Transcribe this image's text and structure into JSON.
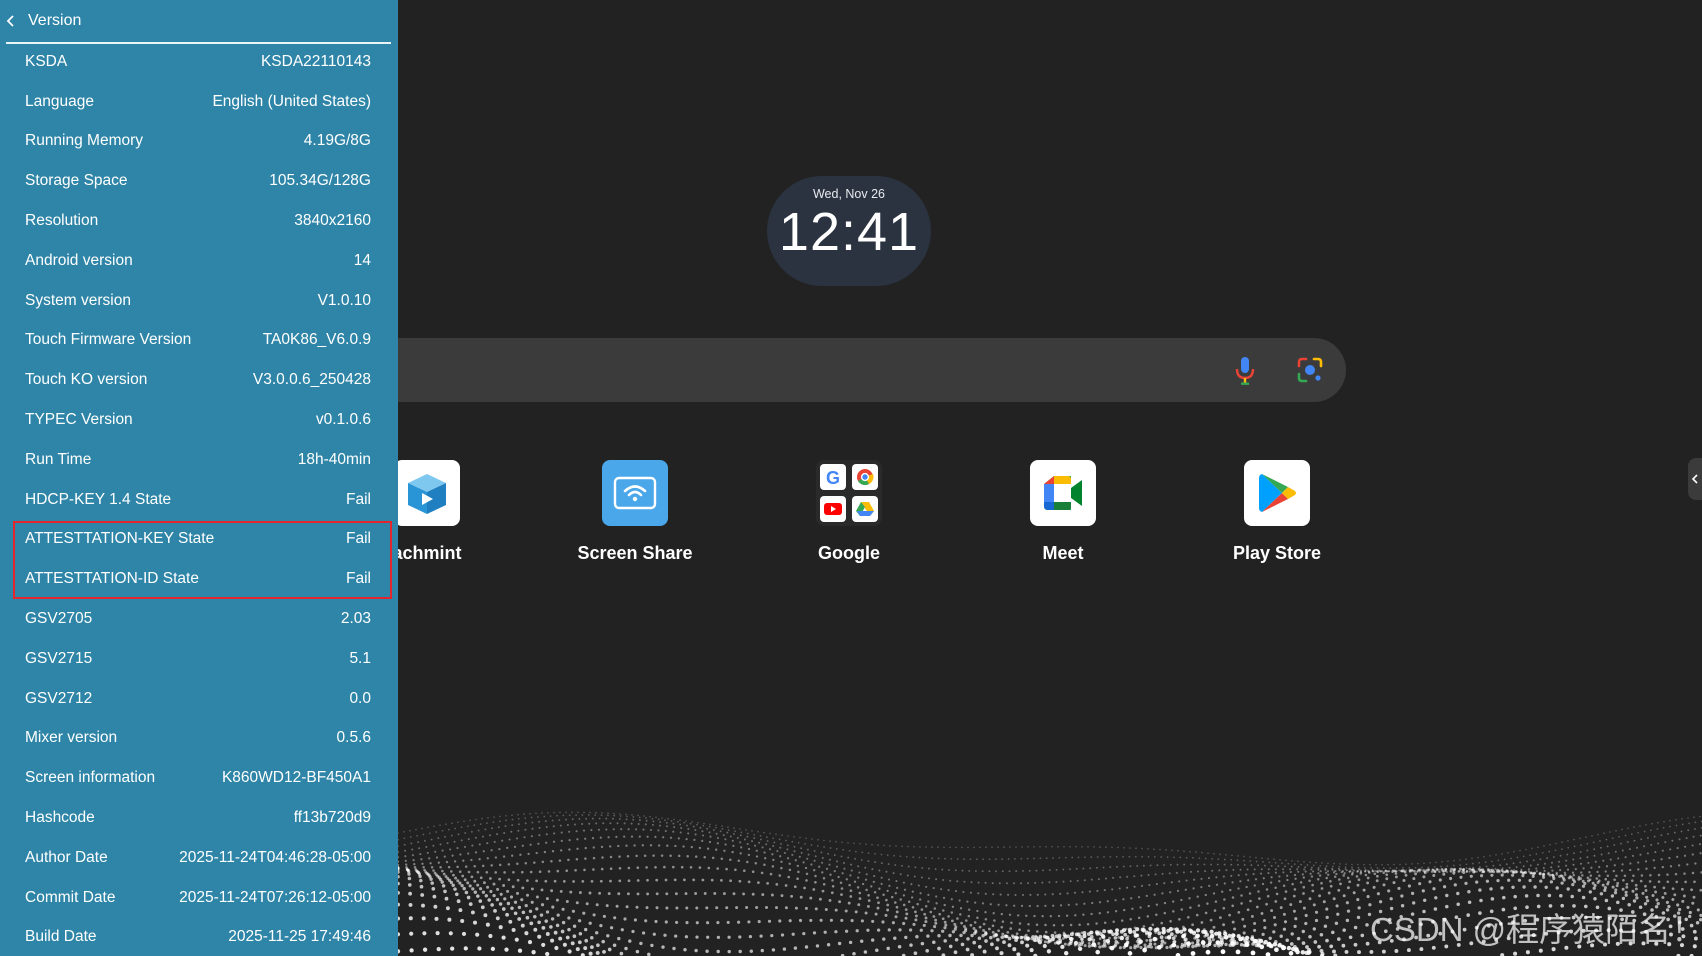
{
  "panel": {
    "title": "Version",
    "rows": [
      {
        "label": "KSDA",
        "value": "KSDA22110143"
      },
      {
        "label": "Language",
        "value": "English (United States)"
      },
      {
        "label": "Running Memory",
        "value": "4.19G/8G"
      },
      {
        "label": "Storage Space",
        "value": "105.34G/128G"
      },
      {
        "label": "Resolution",
        "value": "3840x2160"
      },
      {
        "label": "Android version",
        "value": "14"
      },
      {
        "label": "System version",
        "value": "V1.0.10"
      },
      {
        "label": "Touch Firmware Version",
        "value": "TA0K86_V6.0.9"
      },
      {
        "label": "Touch KO version",
        "value": "V3.0.0.6_250428"
      },
      {
        "label": "TYPEC Version",
        "value": "v0.1.0.6"
      },
      {
        "label": "Run Time",
        "value": "18h-40min"
      },
      {
        "label": "HDCP-KEY 1.4 State",
        "value": "Fail"
      },
      {
        "label": "ATTESTTATION-KEY State",
        "value": "Fail"
      },
      {
        "label": "ATTESTTATION-ID State",
        "value": "Fail"
      },
      {
        "label": "GSV2705",
        "value": "2.03"
      },
      {
        "label": "GSV2715",
        "value": "5.1"
      },
      {
        "label": "GSV2712",
        "value": "0.0"
      },
      {
        "label": "Mixer version",
        "value": "0.5.6"
      },
      {
        "label": "Screen information",
        "value": "K860WD12-BF450A1"
      },
      {
        "label": "Hashcode",
        "value": "ff13b720d9"
      },
      {
        "label": "Author Date",
        "value": "2025-11-24T04:46:28-05:00"
      },
      {
        "label": "Commit Date",
        "value": "2025-11-24T07:26:12-05:00"
      },
      {
        "label": "Build Date",
        "value": "2025-11-25 17:49:46"
      }
    ]
  },
  "clock": {
    "date": "Wed, Nov 26",
    "time": "12:41"
  },
  "search": {
    "icons": [
      "microphone-icon",
      "lens-icon"
    ]
  },
  "apps": [
    {
      "label": "achmint",
      "icon": "video-book-icon"
    },
    {
      "label": "Screen Share",
      "icon": "wifi-screen-icon"
    },
    {
      "label": "Google",
      "icon": "google-folder-icon"
    },
    {
      "label": "Meet",
      "icon": "meet-icon"
    },
    {
      "label": "Play Store",
      "icon": "play-store-icon"
    }
  ],
  "watermark": "CSDN @程序猿陌名！",
  "colors": {
    "panel": "#2e85a7",
    "highlight": "#e3262e",
    "background": "#222222"
  }
}
